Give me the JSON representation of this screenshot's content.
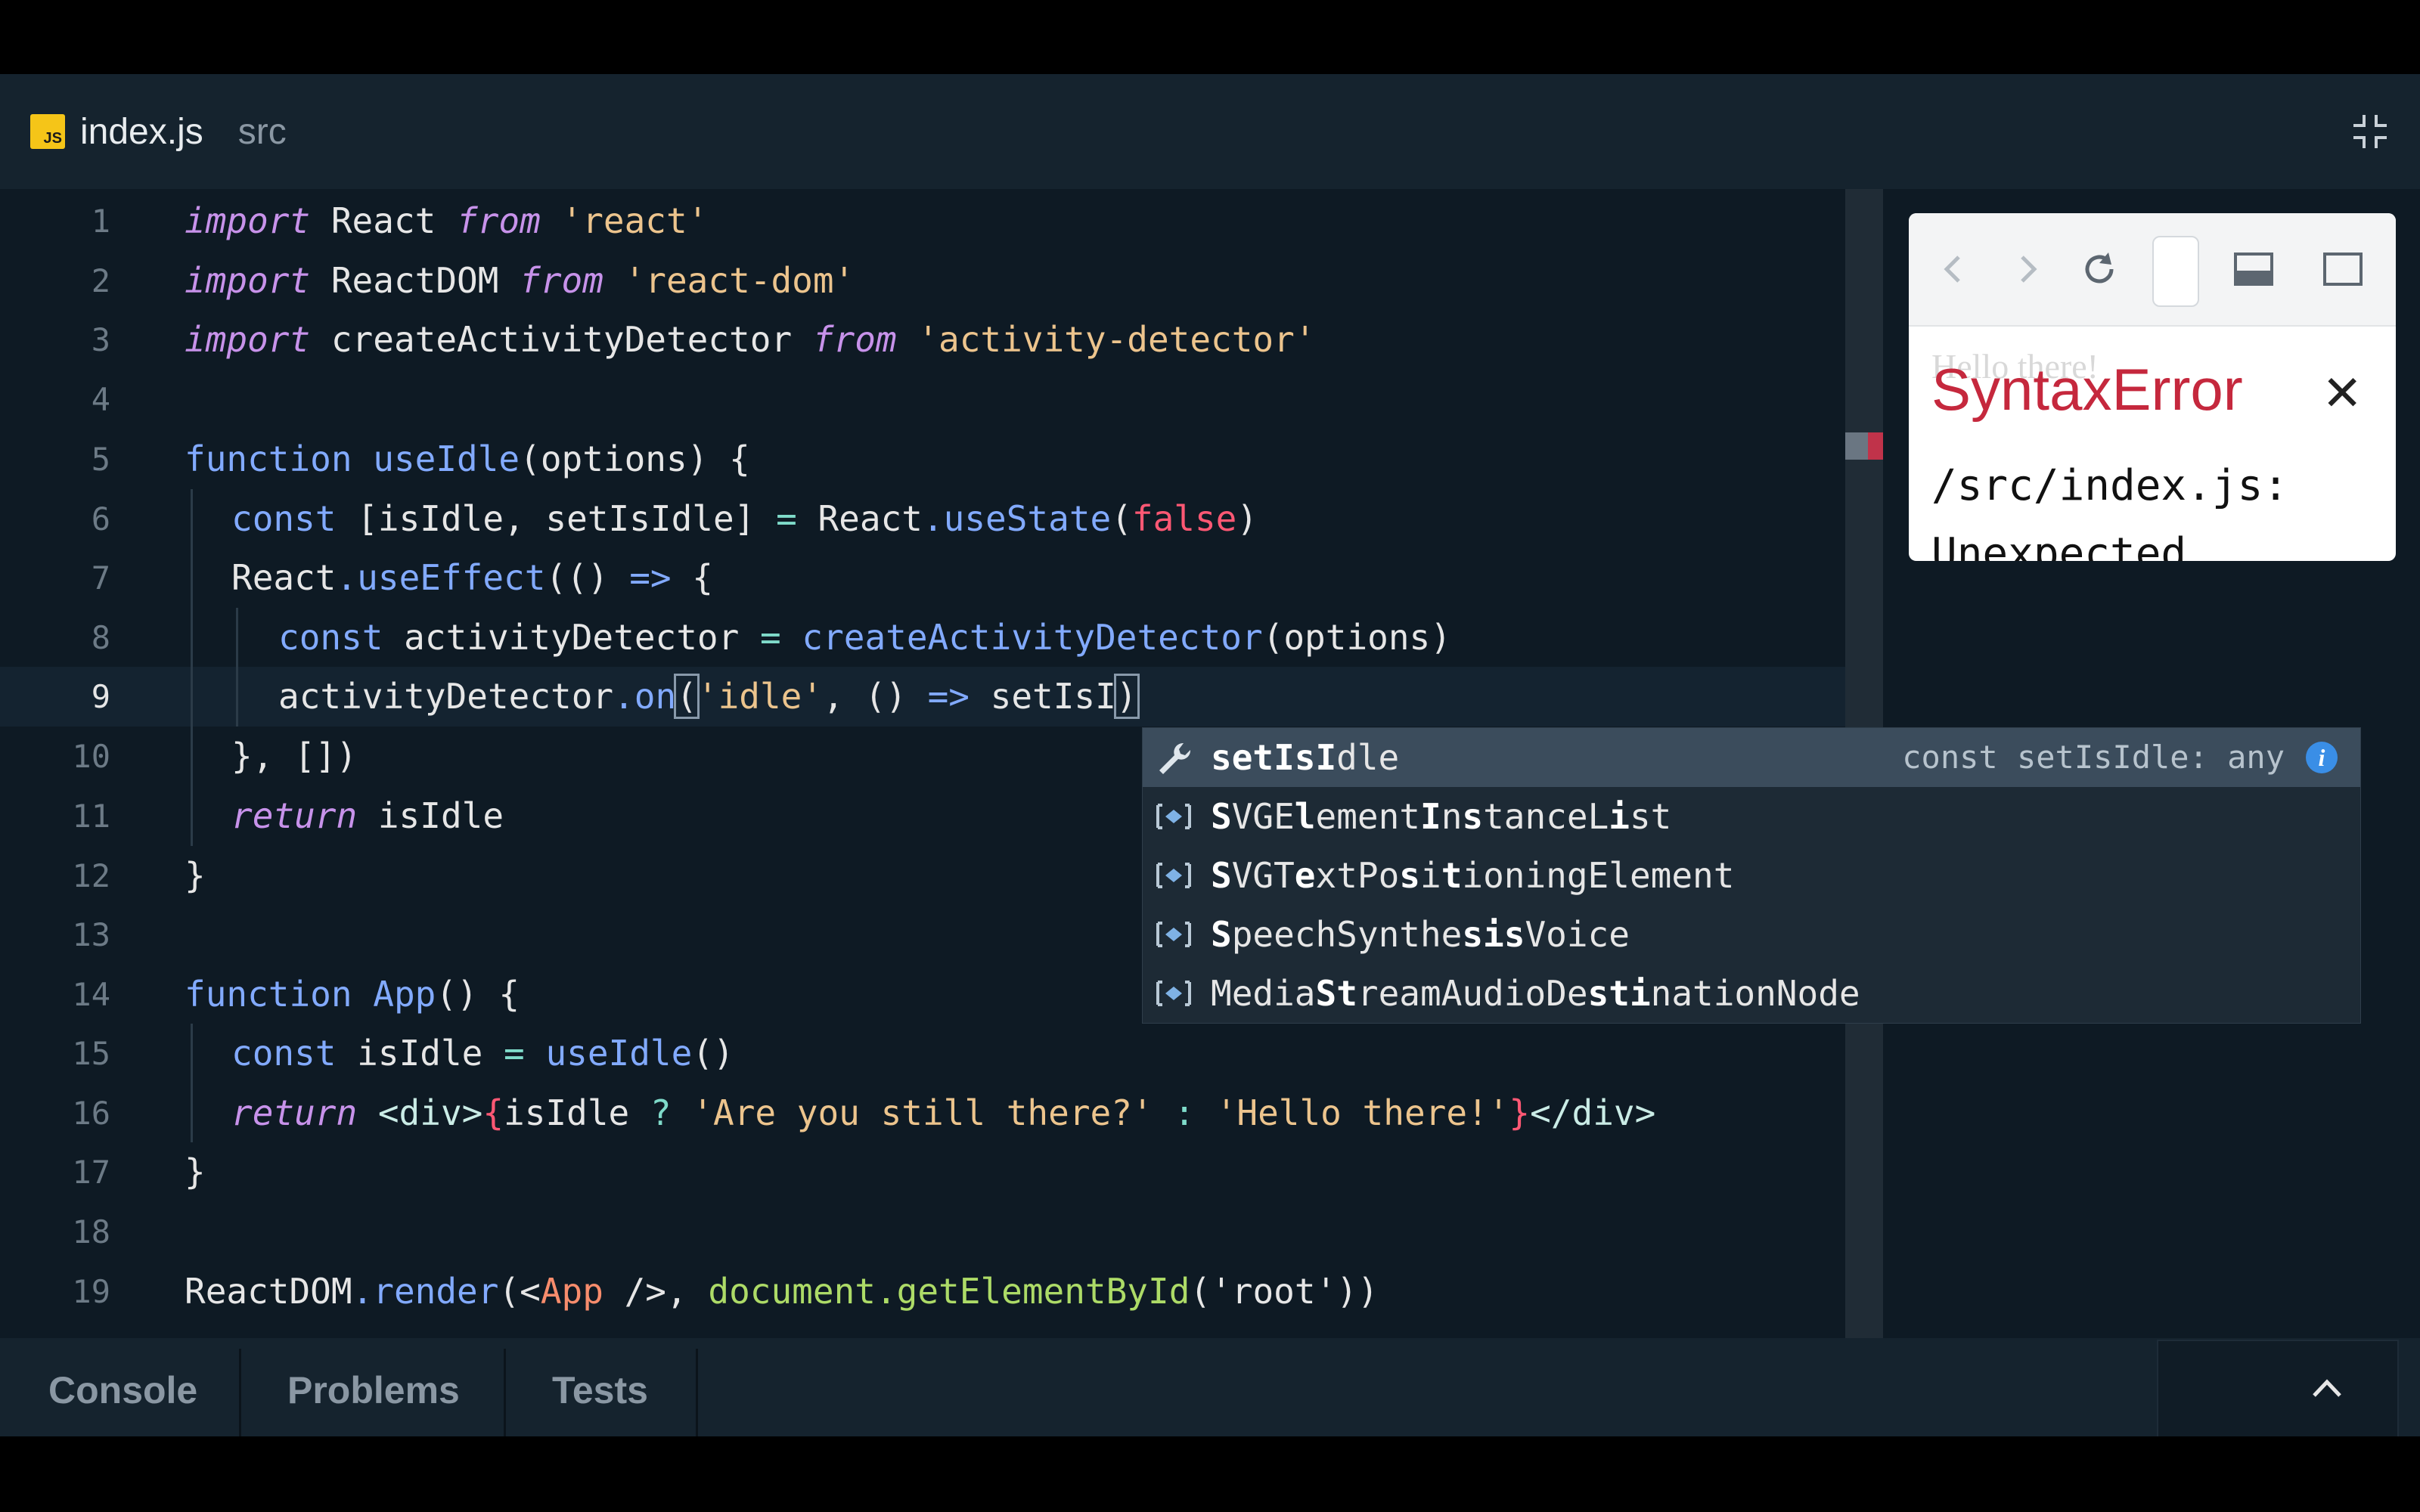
{
  "tab": {
    "file": "index.js",
    "dir": "src",
    "badge": "JS"
  },
  "lines": [
    {
      "num": "1"
    },
    {
      "num": "2"
    },
    {
      "num": "3"
    },
    {
      "num": "4"
    },
    {
      "num": "5"
    },
    {
      "num": "6"
    },
    {
      "num": "7"
    },
    {
      "num": "8"
    },
    {
      "num": "9"
    },
    {
      "num": "10"
    },
    {
      "num": "11"
    },
    {
      "num": "12"
    },
    {
      "num": "13"
    },
    {
      "num": "14"
    },
    {
      "num": "15"
    },
    {
      "num": "16"
    },
    {
      "num": "17"
    },
    {
      "num": "18"
    },
    {
      "num": "19"
    }
  ],
  "code": {
    "l1": {
      "a": "import",
      "b": " React ",
      "c": "from",
      "d": " 'react'"
    },
    "l2": {
      "a": "import",
      "b": " ReactDOM ",
      "c": "from",
      "d": " 'react-dom'"
    },
    "l3": {
      "a": "import",
      "b": " createActivityDetector ",
      "c": "from",
      "d": " 'activity-detector'"
    },
    "l5": {
      "a": "function",
      "b": " useIdle",
      "c": "(options) {"
    },
    "l6": {
      "a": "const",
      "b": " [isIdle, setIsIdle] ",
      "c": "=",
      "d": " React",
      "e": ".useState",
      "f": "(",
      "g": "false",
      "h": ")"
    },
    "l7": {
      "a": "React",
      "b": ".useEffect",
      "c": "(() ",
      "d": "=>",
      "e": " {"
    },
    "l8": {
      "a": "const",
      "b": " activityDetector ",
      "c": "=",
      "d": " createActivityDetector",
      "e": "(options)"
    },
    "l9": {
      "a": "activityDetector",
      "b": ".on",
      "c": "(",
      "d": "'idle'",
      "e": ", () ",
      "f": "=>",
      "g": " setIsI",
      "h": ")"
    },
    "l10": {
      "a": "}, [])"
    },
    "l11": {
      "a": "return",
      "b": " isIdle"
    },
    "l12": {
      "a": "}"
    },
    "l14": {
      "a": "function",
      "b": " App",
      "c": "() {"
    },
    "l15": {
      "a": "const",
      "b": " isIdle ",
      "c": "=",
      "d": " useIdle",
      "e": "()"
    },
    "l16": {
      "a": "return",
      "b": " <div>",
      "c": "{",
      "d": "isIdle ",
      "e": "?",
      "f": " 'Are you still there?' ",
      "g": ":",
      "h": " 'Hello there!'",
      "i": "}",
      "j": "</div>"
    },
    "l17": {
      "a": "}"
    },
    "l19": {
      "a": "ReactDOM",
      "b": ".render",
      "c": "(<",
      "d": "App",
      "e": " />, ",
      "f": "document",
      "g": ".getElementById",
      "h": "('root'))"
    }
  },
  "autocomplete": {
    "items": [
      {
        "pre": "",
        "bold1": "setIsI",
        "rest": "dle",
        "detail": "const setIsIdle: any"
      },
      {
        "parts": [
          "",
          "S",
          "VGE",
          "l",
          "ement",
          "I",
          "n",
          "s",
          "tanceL",
          "i",
          "st"
        ]
      },
      {
        "parts": [
          "",
          "S",
          "VGT",
          "e",
          "xtPo",
          "s",
          "i",
          "t",
          "ioningElement",
          "",
          ""
        ]
      },
      {
        "parts": [
          "",
          "S",
          "peechSynthe",
          "s",
          "",
          "i",
          "",
          "s",
          "Voice",
          "",
          ""
        ]
      },
      {
        "parts": [
          "Media",
          "S",
          "",
          "t",
          "reamAudioDe",
          "s",
          "",
          "t",
          "",
          "i",
          "nationNode"
        ]
      }
    ]
  },
  "preview": {
    "ghost": "Hello there!",
    "error_title": "SyntaxError",
    "close": "✕",
    "path": "/src/index.js:",
    "more": "Unexpected"
  },
  "bottom_tabs": [
    "Console",
    "Problems",
    "Tests"
  ],
  "colors": {
    "accent": "#82aaff",
    "error": "#c5283d",
    "badge": "#f5c518"
  }
}
